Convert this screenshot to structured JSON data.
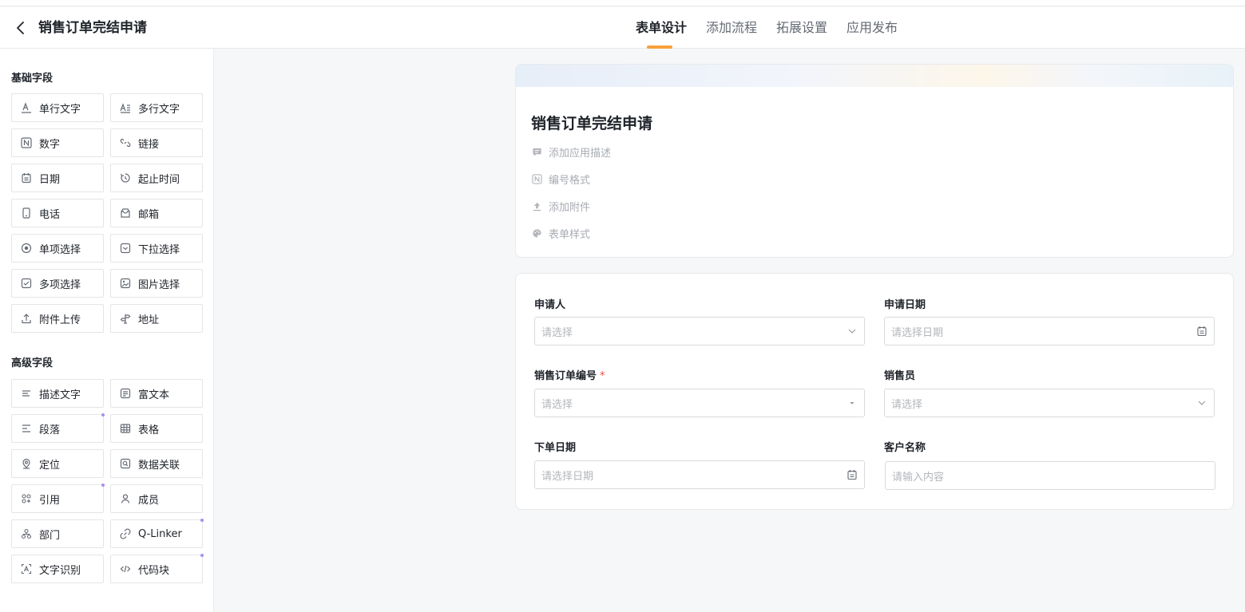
{
  "header": {
    "title": "销售订单完结申请",
    "tabs": [
      {
        "label": "表单设计",
        "active": true
      },
      {
        "label": "添加流程"
      },
      {
        "label": "拓展设置"
      },
      {
        "label": "应用发布"
      }
    ]
  },
  "sidebar": {
    "basic_title": "基础字段",
    "advanced_title": "高级字段",
    "basic": [
      {
        "label": "单行文字",
        "icon": "single-line-text-icon"
      },
      {
        "label": "多行文字",
        "icon": "multi-line-text-icon"
      },
      {
        "label": "数字",
        "icon": "number-icon"
      },
      {
        "label": "链接",
        "icon": "link-icon"
      },
      {
        "label": "日期",
        "icon": "calendar-icon"
      },
      {
        "label": "起止时间",
        "icon": "time-range-icon"
      },
      {
        "label": "电话",
        "icon": "phone-icon"
      },
      {
        "label": "邮箱",
        "icon": "mail-icon"
      },
      {
        "label": "单项选择",
        "icon": "radio-icon"
      },
      {
        "label": "下拉选择",
        "icon": "dropdown-icon"
      },
      {
        "label": "多项选择",
        "icon": "checkbox-icon"
      },
      {
        "label": "图片选择",
        "icon": "image-icon"
      },
      {
        "label": "附件上传",
        "icon": "upload-icon"
      },
      {
        "label": "地址",
        "icon": "address-icon"
      }
    ],
    "advanced": [
      {
        "label": "描述文字",
        "icon": "description-icon"
      },
      {
        "label": "富文本",
        "icon": "rich-text-icon"
      },
      {
        "label": "段落",
        "icon": "paragraph-icon"
      },
      {
        "label": "表格",
        "icon": "table-icon"
      },
      {
        "label": "定位",
        "icon": "location-icon"
      },
      {
        "label": "数据关联",
        "icon": "data-link-icon"
      },
      {
        "label": "引用",
        "icon": "reference-icon"
      },
      {
        "label": "成员",
        "icon": "member-icon"
      },
      {
        "label": "部门",
        "icon": "department-icon"
      },
      {
        "label": "Q-Linker",
        "icon": "q-linker-icon"
      },
      {
        "label": "文字识别",
        "icon": "ocr-icon"
      },
      {
        "label": "代码块",
        "icon": "code-icon"
      }
    ]
  },
  "form_header": {
    "title": "销售订单完结申请",
    "actions": [
      {
        "label": "添加应用描述",
        "icon": "comment-icon"
      },
      {
        "label": "编号格式",
        "icon": "number-format-icon"
      },
      {
        "label": "添加附件",
        "icon": "attachment-upload-icon"
      },
      {
        "label": "表单样式",
        "icon": "palette-icon"
      }
    ]
  },
  "form": {
    "fields": [
      {
        "label": "申请人",
        "placeholder": "请选择",
        "suffix": "chevron-down-icon"
      },
      {
        "label": "申请日期",
        "placeholder": "请选择日期",
        "suffix": "calendar-icon"
      },
      {
        "label": "销售订单编号",
        "required_mark": "*",
        "placeholder": "请选择",
        "suffix": "caret-down-icon"
      },
      {
        "label": "销售员",
        "placeholder": "请选择",
        "suffix": "chevron-down-icon"
      },
      {
        "label": "下单日期",
        "placeholder": "请选择日期",
        "suffix": "calendar-icon"
      },
      {
        "label": "客户名称",
        "placeholder": "请输入内容"
      }
    ]
  },
  "colors": {
    "accent": "#f7a13b",
    "required": "#f54a45",
    "new_dot": "#a98cf2"
  }
}
